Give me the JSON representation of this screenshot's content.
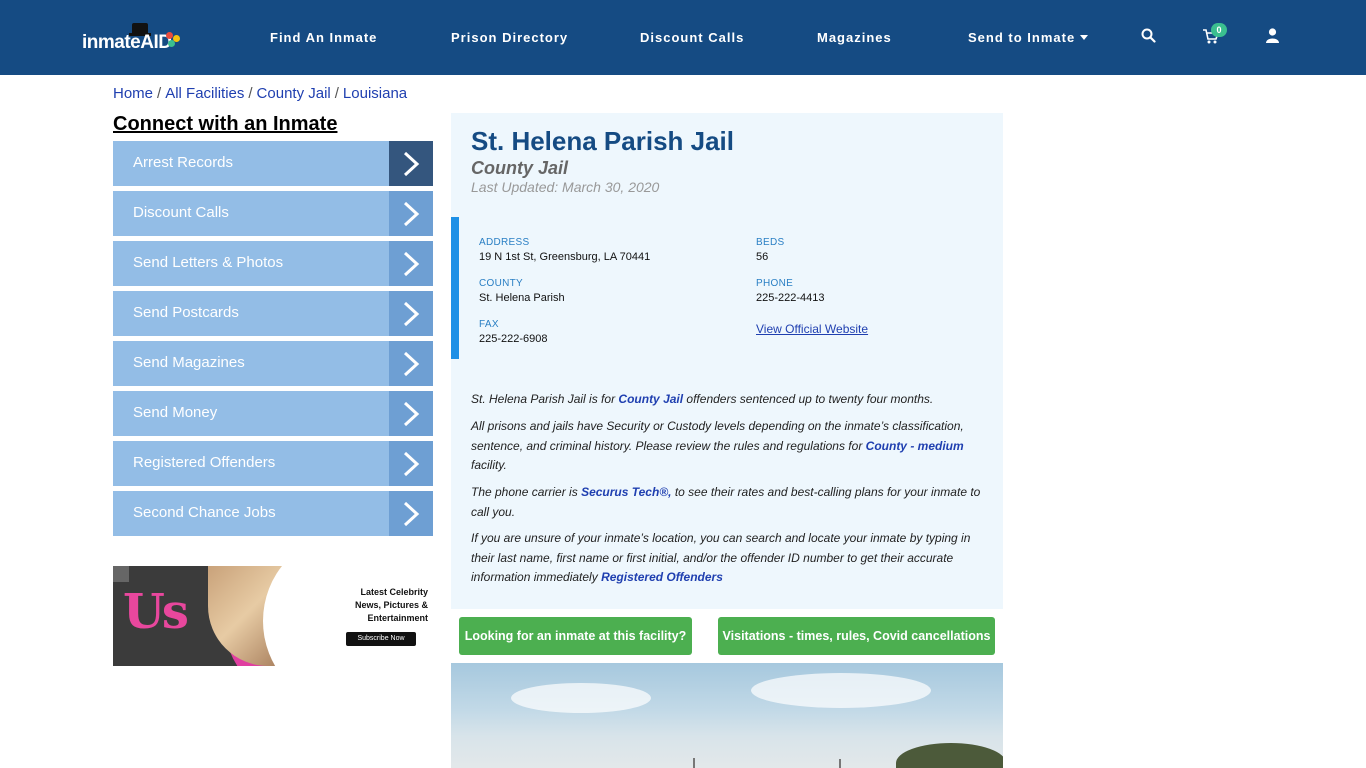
{
  "brand": {
    "logo_text_1": "inmate",
    "logo_text_2": "AID",
    "primary_color": "#154b83",
    "accent_color": "#93bde6",
    "button_color": "#4caf50"
  },
  "nav": {
    "links": [
      "Find An Inmate",
      "Prison Directory",
      "Discount Calls",
      "Magazines",
      "Send to Inmate"
    ],
    "cart_count": "0",
    "icons": [
      "search-icon",
      "cart-icon",
      "user-icon"
    ]
  },
  "breadcrumb": [
    "Home",
    "All Facilities",
    "County Jail",
    "Louisiana"
  ],
  "sidebar": {
    "title": "Connect with an Inmate",
    "items": [
      "Arrest Records",
      "Discount Calls",
      "Send Letters & Photos",
      "Send Postcards",
      "Send Magazines",
      "Send Money",
      "Registered Offenders",
      "Second Chance Jobs"
    ]
  },
  "ad": {
    "brand": "Us",
    "headline_1": "Latest Celebrity",
    "headline_2": "News, Pictures &",
    "headline_3": "Entertainment",
    "cta": "Subscribe Now"
  },
  "facility": {
    "name": "St. Helena Parish Jail",
    "type": "County Jail",
    "updated": "Last Updated: March 30, 2020",
    "address_label": "ADDRESS",
    "address": "19 N 1st St, Greensburg, LA 70441",
    "beds_label": "BEDS",
    "beds": "56",
    "county_label": "COUNTY",
    "county": "St. Helena Parish",
    "phone_label": "PHONE",
    "phone": "225-222-4413",
    "fax_label": "FAX",
    "fax": "225-222-6908",
    "website_link": "View Official Website"
  },
  "description": {
    "p1_a": "St. Helena Parish Jail is for ",
    "p1_link": "County Jail",
    "p1_b": " offenders sentenced up to twenty four months.",
    "p2_a": "All prisons and jails have Security or Custody levels depending on the inmate’s classification, sentence, and criminal history. Please review the rules and regulations for ",
    "p2_link": "County - medium",
    "p2_b": " facility.",
    "p3_a": "The phone carrier is ",
    "p3_link": "Securus Tech®,",
    "p3_b": " to see their rates and best-calling plans for your inmate to call you.",
    "p4_a": "If you are unsure of your inmate’s location, you can search and locate your inmate by typing in their last name, first name or first initial, and/or the offender ID number to get their accurate information immediately ",
    "p4_link": "Registered Offenders"
  },
  "buttons": {
    "find_inmate": "Looking for an inmate at this facility?",
    "visitation": "Visitations - times, rules, Covid cancellations"
  }
}
